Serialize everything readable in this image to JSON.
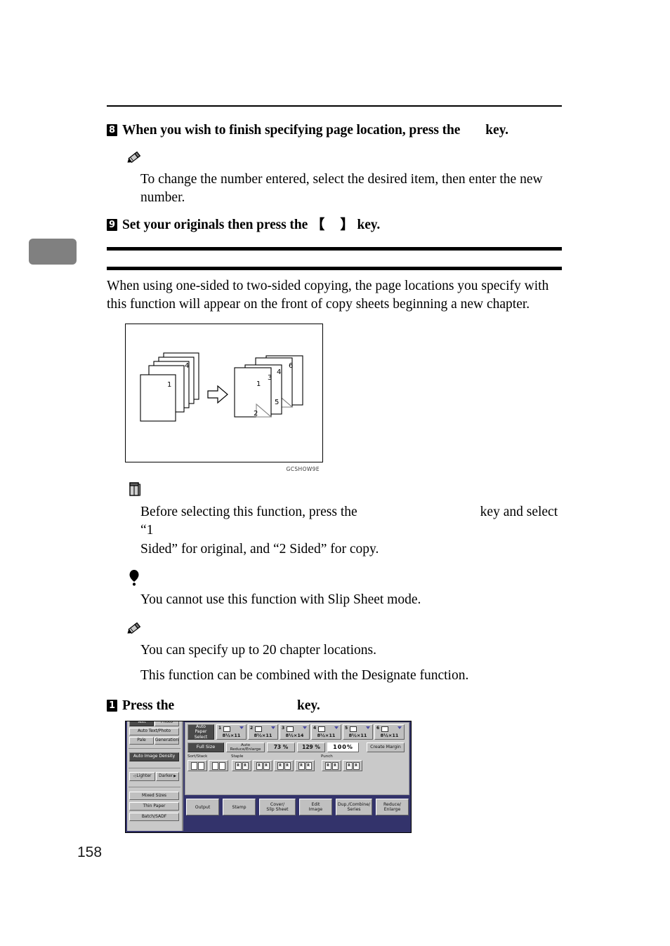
{
  "page": {
    "number": "158"
  },
  "steps": {
    "step8": {
      "num": "8",
      "text_before": "When you wish to finish specifying page location, press the",
      "text_after": "key."
    },
    "step9": {
      "num": "9",
      "text_before": "Set your originals then press the",
      "bracket_open": "【",
      "bracket_close": "】",
      "text_after": "key."
    },
    "step1": {
      "num": "1",
      "text_before": "Press the",
      "text_after": "key."
    }
  },
  "notes": {
    "note1": {
      "icon": "pencil-icon",
      "lines": [
        "To change the number entered, select the desired item, then enter the new number."
      ]
    },
    "reference": {
      "icon": "book-icon",
      "line1_before": "Before selecting this function, press the",
      "line1_after": "key and select “1",
      "line2": "Sided” for original, and “2 Sided” for copy."
    },
    "important": {
      "icon": "balloon-icon",
      "lines": [
        "You cannot use this function with Slip Sheet mode."
      ]
    },
    "note2": {
      "icon": "pencil-icon",
      "lines": [
        "You can specify up to 20 chapter locations.",
        "This function can be combined with the Designate function."
      ]
    }
  },
  "intro": {
    "paragraph": "When using one-sided to two-sided copying, the page locations you specify with this function will appear on the front of copy sheets beginning a new chapter."
  },
  "figure": {
    "caption": "GCSHOW9E",
    "originals_labels": [
      "1",
      "4"
    ],
    "copies_labels": [
      "1",
      "2",
      "3",
      "4",
      "5",
      "6"
    ]
  },
  "lcd": {
    "left_column": {
      "row_split_top": [
        "Text",
        "Photo"
      ],
      "auto_text_photo": "Auto Text/Photo",
      "row_split_2": [
        "Pale",
        "Generation"
      ],
      "auto_image_density": "Auto Image Density",
      "lighter": "Lighter",
      "darker": "Darker",
      "lighter_arrow": "◁",
      "darker_arrow": "▶",
      "mixed_sizes": "Mixed Sizes",
      "thin_paper": "Thin Paper",
      "batch_sadf": "Batch/SADF"
    },
    "paper_select": {
      "label_line1": "Auto",
      "label_line2": "Paper Select",
      "trays": [
        {
          "num": "1",
          "size": "8½×11"
        },
        {
          "num": "2",
          "size": "8½×11"
        },
        {
          "num": "3",
          "size": "8½×14"
        },
        {
          "num": "4",
          "size": "8½×11"
        },
        {
          "num": "5",
          "size": "8½×11"
        },
        {
          "num": "6",
          "size": "8½×11"
        }
      ]
    },
    "zoom_row": {
      "full_size": "Full Size",
      "auto_reduce_enlarge": "Auto Reduce/Enlarge",
      "ratio_73": "73 %",
      "ratio_129": "129 %",
      "ratio_100": "100%",
      "create_margin": "Create Margin"
    },
    "finisher": {
      "sort_stack_label": "Sort/Stack",
      "staple_label": "Staple",
      "punch_label": "Punch",
      "sort_stack_count": 4,
      "staple_count": 4,
      "punch_count": 2
    },
    "bottom_buttons": [
      {
        "line1": "Output",
        "line2": ""
      },
      {
        "line1": "Stamp",
        "line2": ""
      },
      {
        "line1": "Cover/",
        "line2": "Slip Sheet"
      },
      {
        "line1": "Edit",
        "line2": "Image"
      },
      {
        "line1": "Dup./Combine/",
        "line2": "Series"
      },
      {
        "line1": "Reduce/",
        "line2": "Enlarge"
      }
    ]
  },
  "colors": {
    "lcd_background": "#33336b",
    "panel_gray": "#c9c9c9",
    "button_gray": "#c0c0c0",
    "selected_dark": "#4a4a4a",
    "tab_gray": "#808080"
  }
}
